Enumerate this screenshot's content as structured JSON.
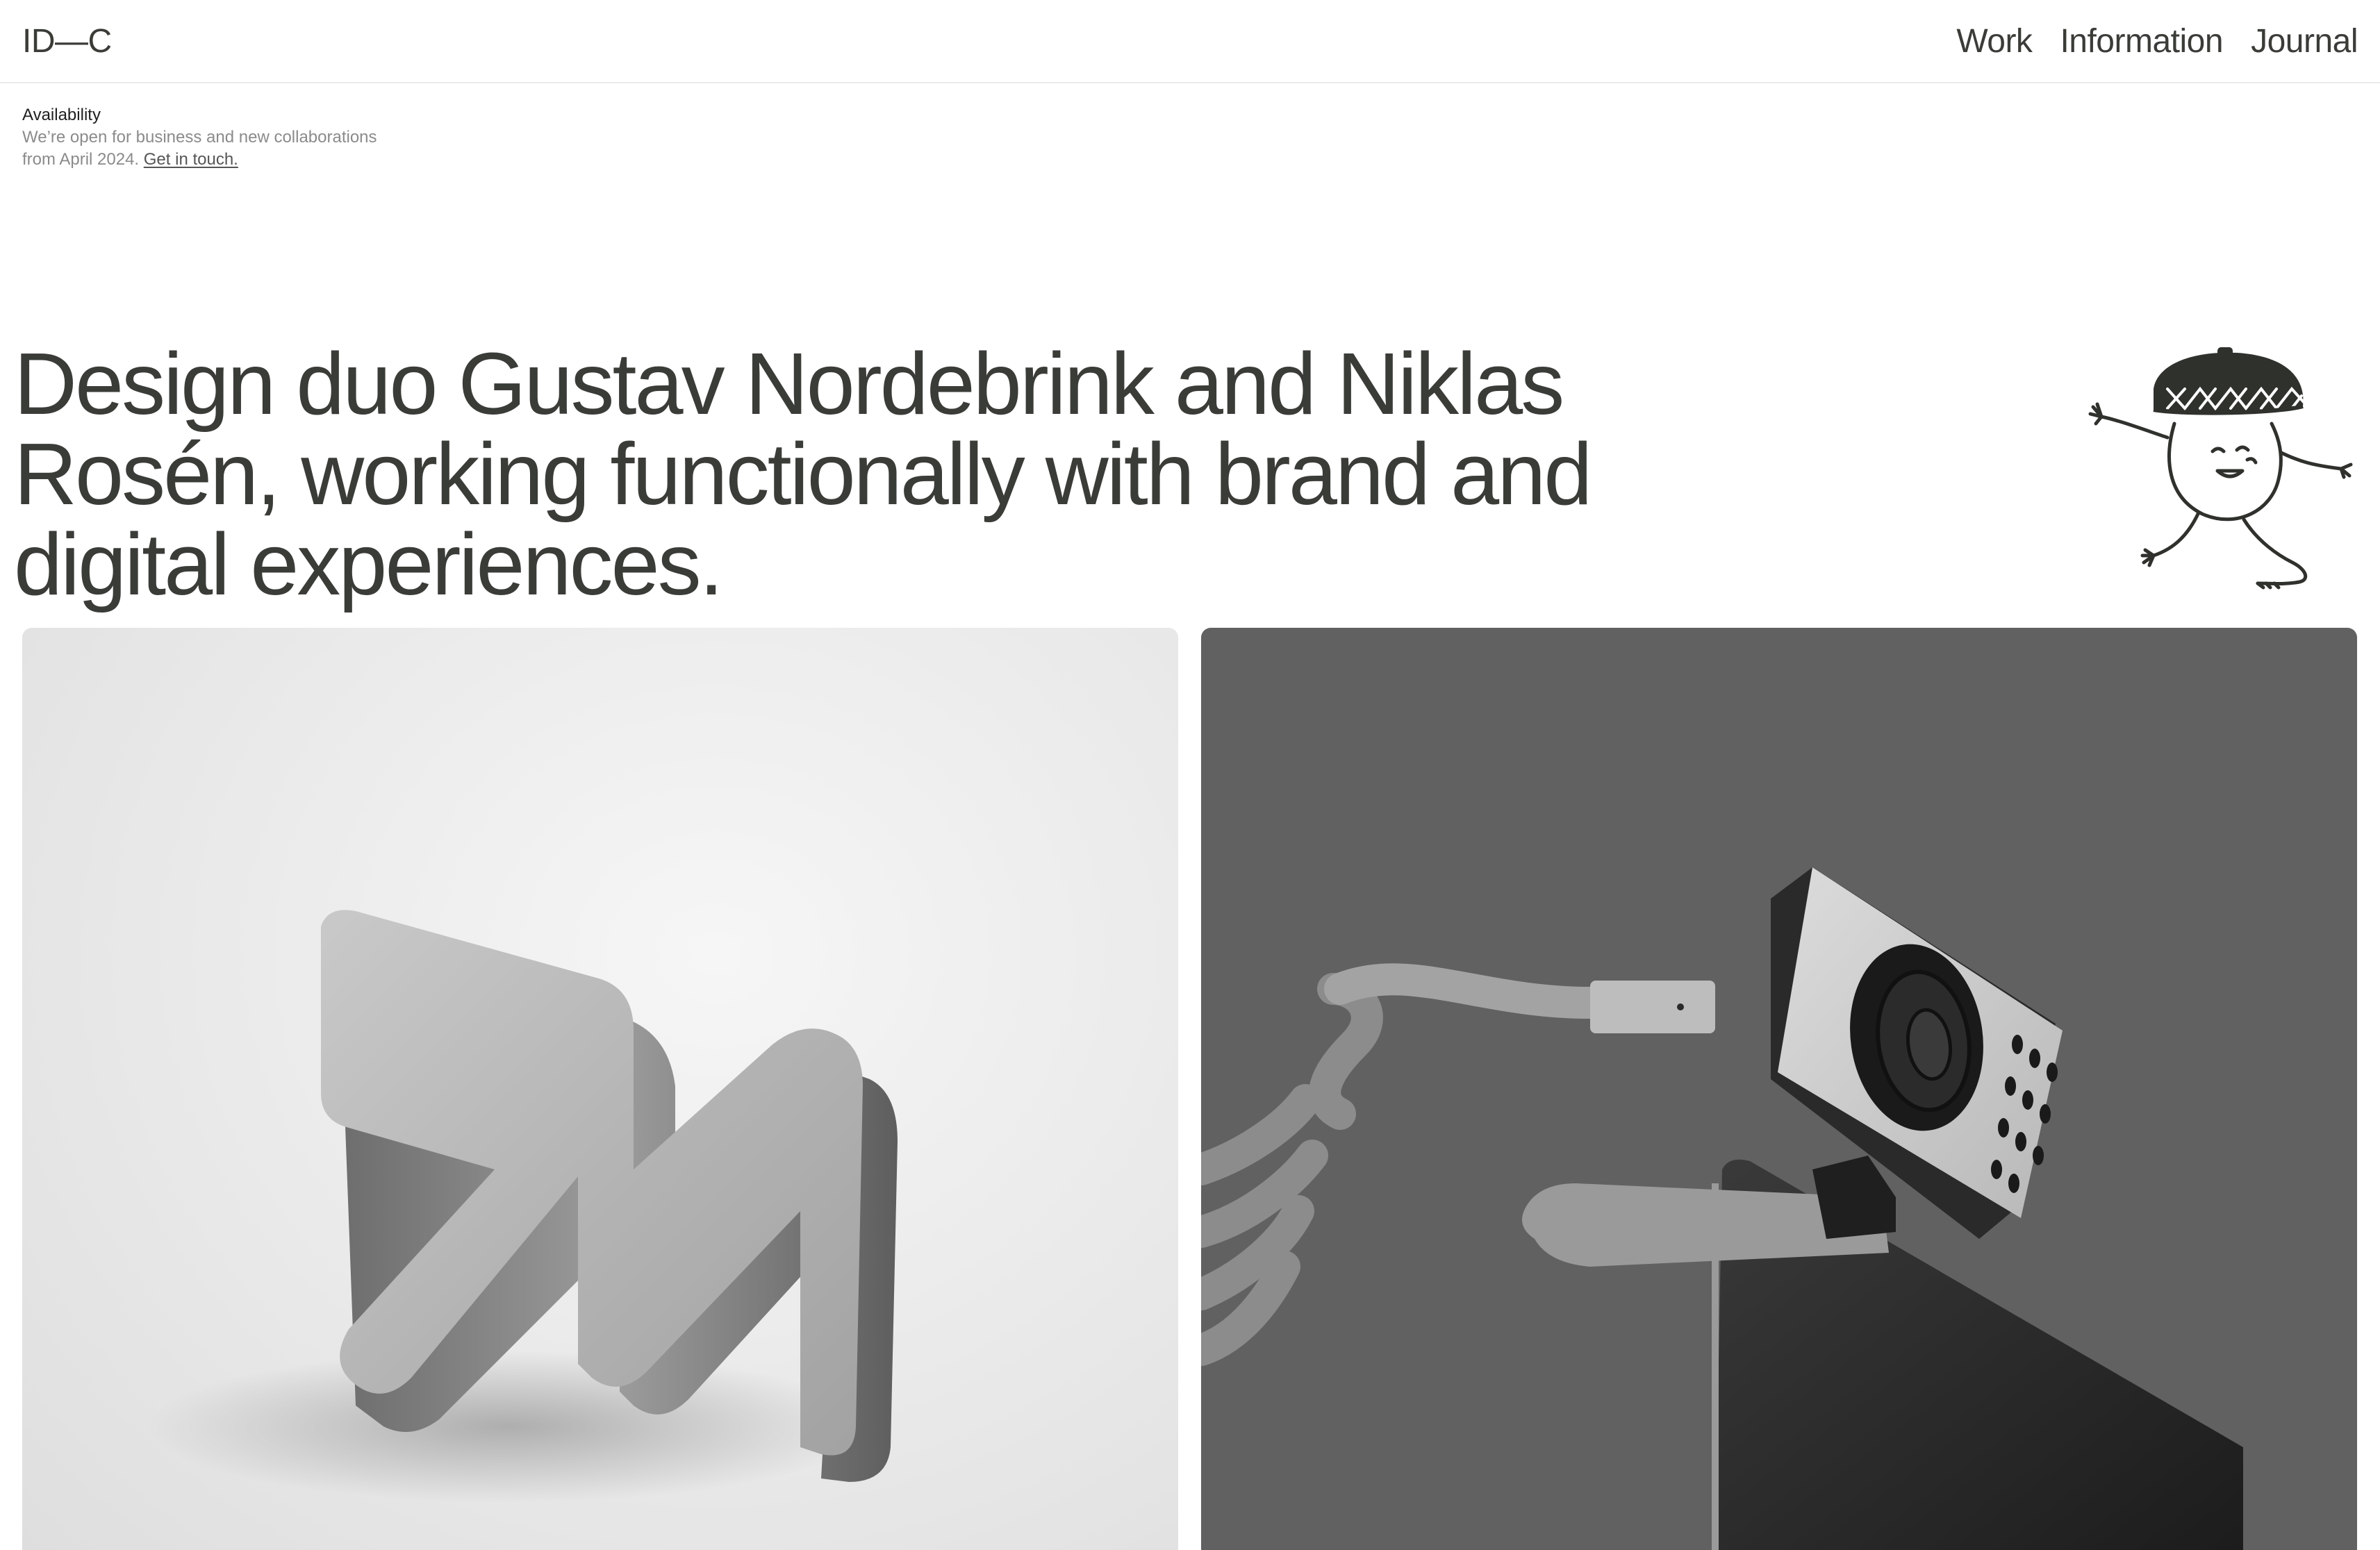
{
  "header": {
    "logo": "ID—C",
    "nav": [
      {
        "label": "Work"
      },
      {
        "label": "Information"
      },
      {
        "label": "Journal"
      }
    ]
  },
  "availability": {
    "title": "Availability",
    "line1": "We’re open for business and new collaborations",
    "line2": "from April 2024.",
    "link": "Get in touch."
  },
  "hero": {
    "headline": "Design duo Gustav Nordebrink and Niklas Rosén, working functionally with brand and digital experiences."
  },
  "colors": {
    "text": "#3a3c38",
    "muted": "#8b8b8b",
    "card_light": "#e9e9e9",
    "card_dark": "#616161"
  },
  "icons": {
    "mascot": "acorn-character-walking-icon"
  }
}
